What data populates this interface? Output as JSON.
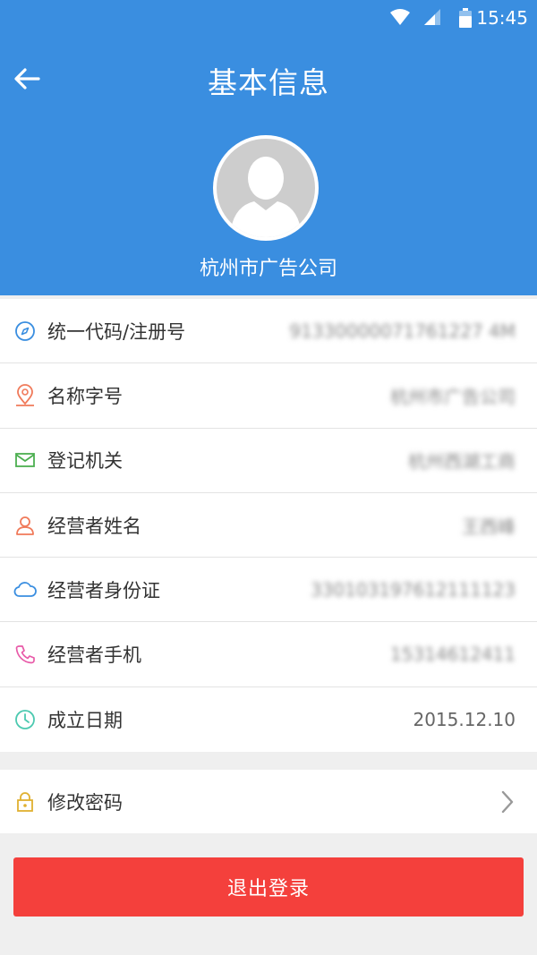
{
  "status_bar": {
    "time": "15:45"
  },
  "header": {
    "title": "基本信息",
    "company_name": "杭州市广告公司"
  },
  "info_rows": [
    {
      "icon": "compass-icon",
      "icon_color": "#3a8ee0",
      "label": "统一代码/注册号",
      "value": "91330000071761227 4M"
    },
    {
      "icon": "location-pin-icon",
      "icon_color": "#f07a5a",
      "label": "名称字号",
      "value": "杭州市广告公司"
    },
    {
      "icon": "mail-icon",
      "icon_color": "#4caf50",
      "label": "登记机关",
      "value": "杭州西湖工商"
    },
    {
      "icon": "person-icon",
      "icon_color": "#f07a5a",
      "label": "经营者姓名",
      "value": "王西峰"
    },
    {
      "icon": "cloud-icon",
      "icon_color": "#3a8ee0",
      "label": "经营者身份证",
      "value": "330103197612111123"
    },
    {
      "icon": "phone-icon",
      "icon_color": "#e85aa8",
      "label": "经营者手机",
      "value": "15314612411"
    },
    {
      "icon": "clock-icon",
      "icon_color": "#4cc9b0",
      "label": "成立日期",
      "value": "2015.12.10"
    }
  ],
  "password_row": {
    "icon": "lock-icon",
    "icon_color": "#e0b030",
    "label": "修改密码"
  },
  "logout": {
    "label": "退出登录",
    "color": "#f4403c"
  },
  "colors": {
    "header_bg": "#3a8ee0",
    "page_bg": "#efefef"
  }
}
